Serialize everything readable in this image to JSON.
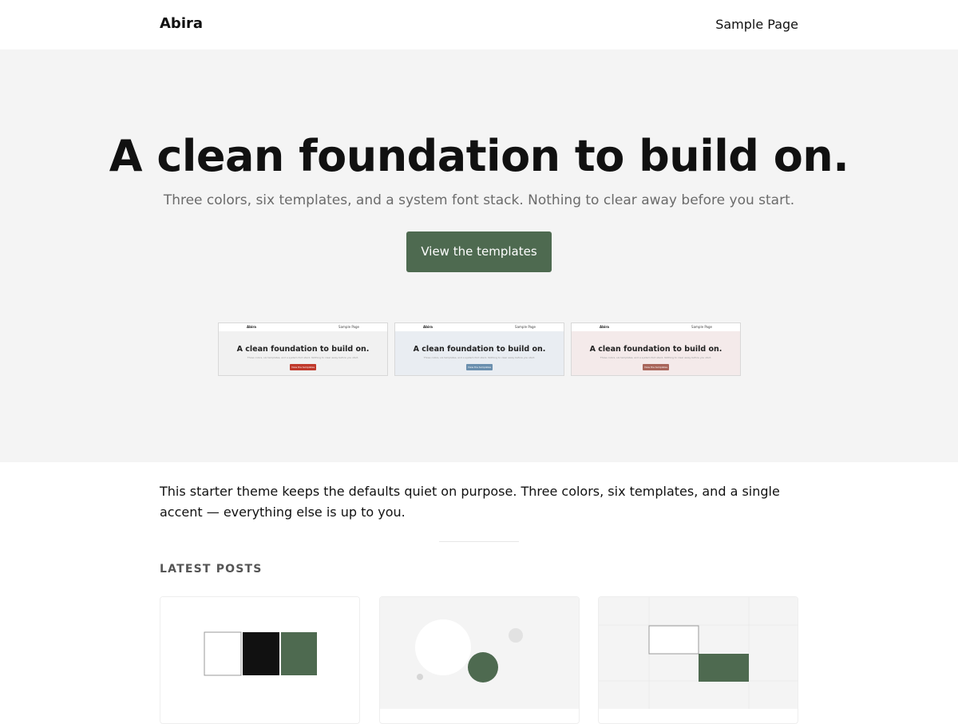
{
  "header": {
    "site_title": "Abira",
    "nav_link": "Sample Page"
  },
  "hero": {
    "title": "A clean foundation to build on.",
    "subtitle": "Three colors, six templates, and a system font stack. Nothing to clear away before you start.",
    "button_label": "View the templates"
  },
  "previews": [
    {
      "site_title": "Abira",
      "nav": "Sample Page",
      "title": "A clean foundation to build on.",
      "subtitle": "Three colors, six templates, and a system font stack. Nothing to clear away before you start.",
      "button_label": "View the templates",
      "bg": "#f1f1f1",
      "accent": "#c0392b"
    },
    {
      "site_title": "Abira",
      "nav": "Sample Page",
      "title": "A clean foundation to build on.",
      "subtitle": "Three colors, six templates, and a system font stack. Nothing to clear away before you start.",
      "button_label": "View the templates",
      "bg": "#e9edf2",
      "accent": "#6a8fae"
    },
    {
      "site_title": "Abira",
      "nav": "Sample Page",
      "title": "A clean foundation to build on.",
      "subtitle": "Three colors, six templates, and a system font stack. Nothing to clear away before you start.",
      "button_label": "View the templates",
      "bg": "#f4eaea",
      "accent": "#a8655a"
    }
  ],
  "intro": {
    "text": "This starter theme keeps the defaults quiet on purpose. Three colors, six templates, and a single accent — everything else is up to you."
  },
  "latest_posts": {
    "label": "LATEST POSTS"
  },
  "colors": {
    "accent": "#4e6a50",
    "hero_bg": "#f4f4f4",
    "text": "#111111",
    "muted": "#6b6b6b"
  }
}
